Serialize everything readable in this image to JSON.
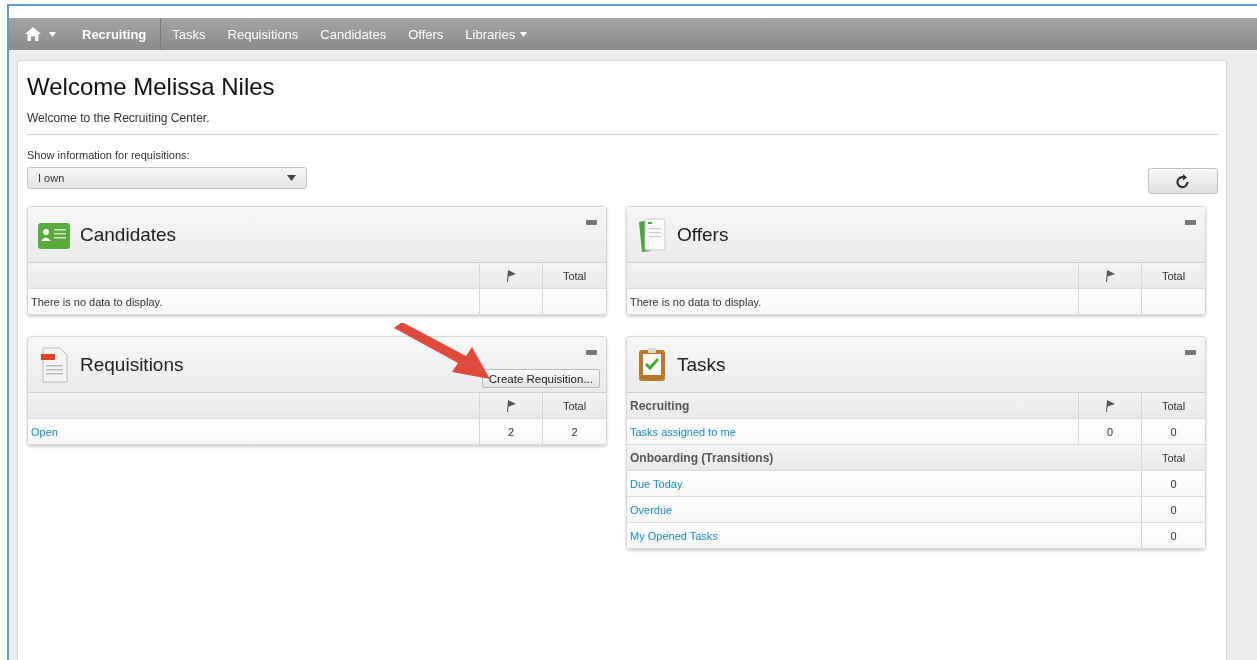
{
  "nav": {
    "items": [
      {
        "label": "Recruiting",
        "selected": true,
        "has_menu": false
      },
      {
        "label": "Tasks",
        "selected": false,
        "has_menu": false
      },
      {
        "label": "Requisitions",
        "selected": false,
        "has_menu": false
      },
      {
        "label": "Candidates",
        "selected": false,
        "has_menu": false
      },
      {
        "label": "Offers",
        "selected": false,
        "has_menu": false
      },
      {
        "label": "Libraries",
        "selected": false,
        "has_menu": true
      }
    ]
  },
  "welcome": {
    "title": "Welcome Melissa Niles",
    "subtitle": "Welcome to the Recruiting Center."
  },
  "filter": {
    "label": "Show information for requisitions:",
    "value": "I own"
  },
  "left_column": [
    {
      "title": "Candidates",
      "kind": "candidates",
      "sections": [
        {
          "flag_column": true,
          "total_label": "Total",
          "rows": [
            {
              "label": "There is no data to display.",
              "link": false
            }
          ]
        }
      ]
    },
    {
      "title": "Requisitions",
      "kind": "requisitions",
      "action": "Create Requisition...",
      "sections": [
        {
          "flag_column": true,
          "total_label": "Total",
          "rows": [
            {
              "label": "Open",
              "link": true,
              "flag": "2",
              "total": "2"
            }
          ]
        }
      ]
    }
  ],
  "right_column": [
    {
      "title": "Offers",
      "kind": "offers",
      "sections": [
        {
          "flag_column": true,
          "total_label": "Total",
          "rows": [
            {
              "label": "There is no data to display.",
              "link": false
            }
          ]
        }
      ]
    },
    {
      "title": "Tasks",
      "kind": "tasks",
      "sections": [
        {
          "heading": "Recruiting",
          "flag_column": true,
          "total_label": "Total",
          "rows": [
            {
              "label": "Tasks assigned to me",
              "link": true,
              "flag": "0",
              "total": "0"
            }
          ]
        },
        {
          "heading": "Onboarding (Transitions)",
          "flag_column": false,
          "total_label": "Total",
          "rows": [
            {
              "label": "Due Today",
              "link": true,
              "total": "0"
            },
            {
              "label": "Overdue",
              "link": true,
              "total": "0"
            },
            {
              "label": "My Opened Tasks",
              "link": true,
              "total": "0"
            }
          ]
        }
      ]
    }
  ],
  "annotation": {
    "kind": "arrow"
  }
}
